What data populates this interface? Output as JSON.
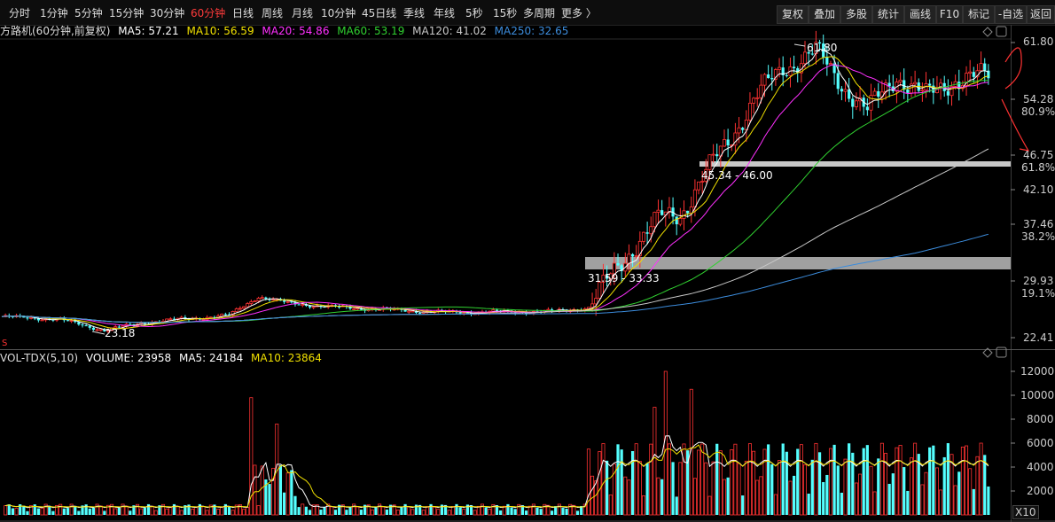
{
  "toolbar": {
    "periods": [
      "分时",
      "1分钟",
      "5分钟",
      "15分钟",
      "30分钟",
      "60分钟",
      "日线",
      "周线",
      "月线",
      "10分钟",
      "45日线",
      "季线",
      "年线",
      "5秒",
      "15秒",
      "多周期",
      "更多 〉"
    ],
    "active_period": "60分钟",
    "buttons": [
      "复权",
      "叠加",
      "多股",
      "统计",
      "画线",
      "F10",
      "标记",
      "-自选",
      "返回"
    ]
  },
  "main_header": {
    "name": "方路机(60分钟,前复权)",
    "ma": [
      {
        "label": "MA5: 57.21",
        "color": "#ffffff"
      },
      {
        "label": "MA10: 56.59",
        "color": "#f0e000"
      },
      {
        "label": "MA20: 54.86",
        "color": "#ff30ff"
      },
      {
        "label": "MA60: 53.19",
        "color": "#30d030"
      },
      {
        "label": "MA120: 41.02",
        "color": "#c8c8c8"
      },
      {
        "label": "MA250: 32.65",
        "color": "#3c8cdc"
      }
    ]
  },
  "volume_header": {
    "name": "VOL-TDX(5,10)",
    "items": [
      {
        "label": "VOLUME: 23958",
        "color": "#ffffff"
      },
      {
        "label": "MA5: 24184",
        "color": "#ffffff"
      },
      {
        "label": "MA10: 23864",
        "color": "#f0e000"
      }
    ]
  },
  "price_axis": [
    "61.80",
    "54.28",
    "46.75",
    "42.10",
    "37.46",
    "29.93",
    "22.41"
  ],
  "pct_axis": [
    "80.9%",
    "61.8%",
    "38.2%",
    "19.1%"
  ],
  "volume_axis": [
    "12000",
    "10000",
    "8000",
    "6000",
    "4000",
    "2000"
  ],
  "volume_unit": "X10",
  "annotations": {
    "high": "61.80",
    "low": "23.18",
    "zone_upper": "45.34 - 46.00",
    "zone_lower": "31.59 - 33.33",
    "marker_s": "S"
  },
  "colors": {
    "up": "#ff3232",
    "down": "#54ffff",
    "ma5": "#ffffff",
    "ma10": "#f0e000",
    "ma20": "#ff30ff",
    "ma60": "#30d030",
    "ma120": "#c8c8c8",
    "ma250": "#3c8cdc"
  }
}
